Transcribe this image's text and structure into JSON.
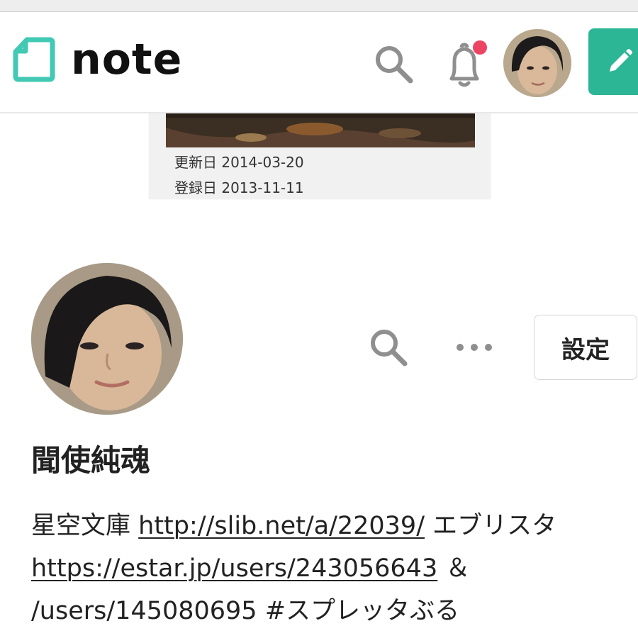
{
  "header": {
    "logo_text": "note",
    "colors": {
      "brand": "#41c9b4",
      "post_button": "#2cb696",
      "notification_dot": "#ec4563"
    },
    "icons": [
      "note-logo-icon",
      "search-icon",
      "bell-icon",
      "pencil-icon"
    ]
  },
  "cover": {
    "updated": "更新日 2014-03-20",
    "registered": "登録日 2013-11-11"
  },
  "profile": {
    "name": "聞使純魂",
    "settings_label": "設定",
    "bio": {
      "prefix": "星空文庫 ",
      "link1": "http://slib.net/a/22039/",
      "middle": " エブリスタ",
      "link2": "https://estar.jp/users/243056643",
      "amp": " ＆",
      "line3": "/users/145080695 #スプレッタぶる"
    }
  }
}
